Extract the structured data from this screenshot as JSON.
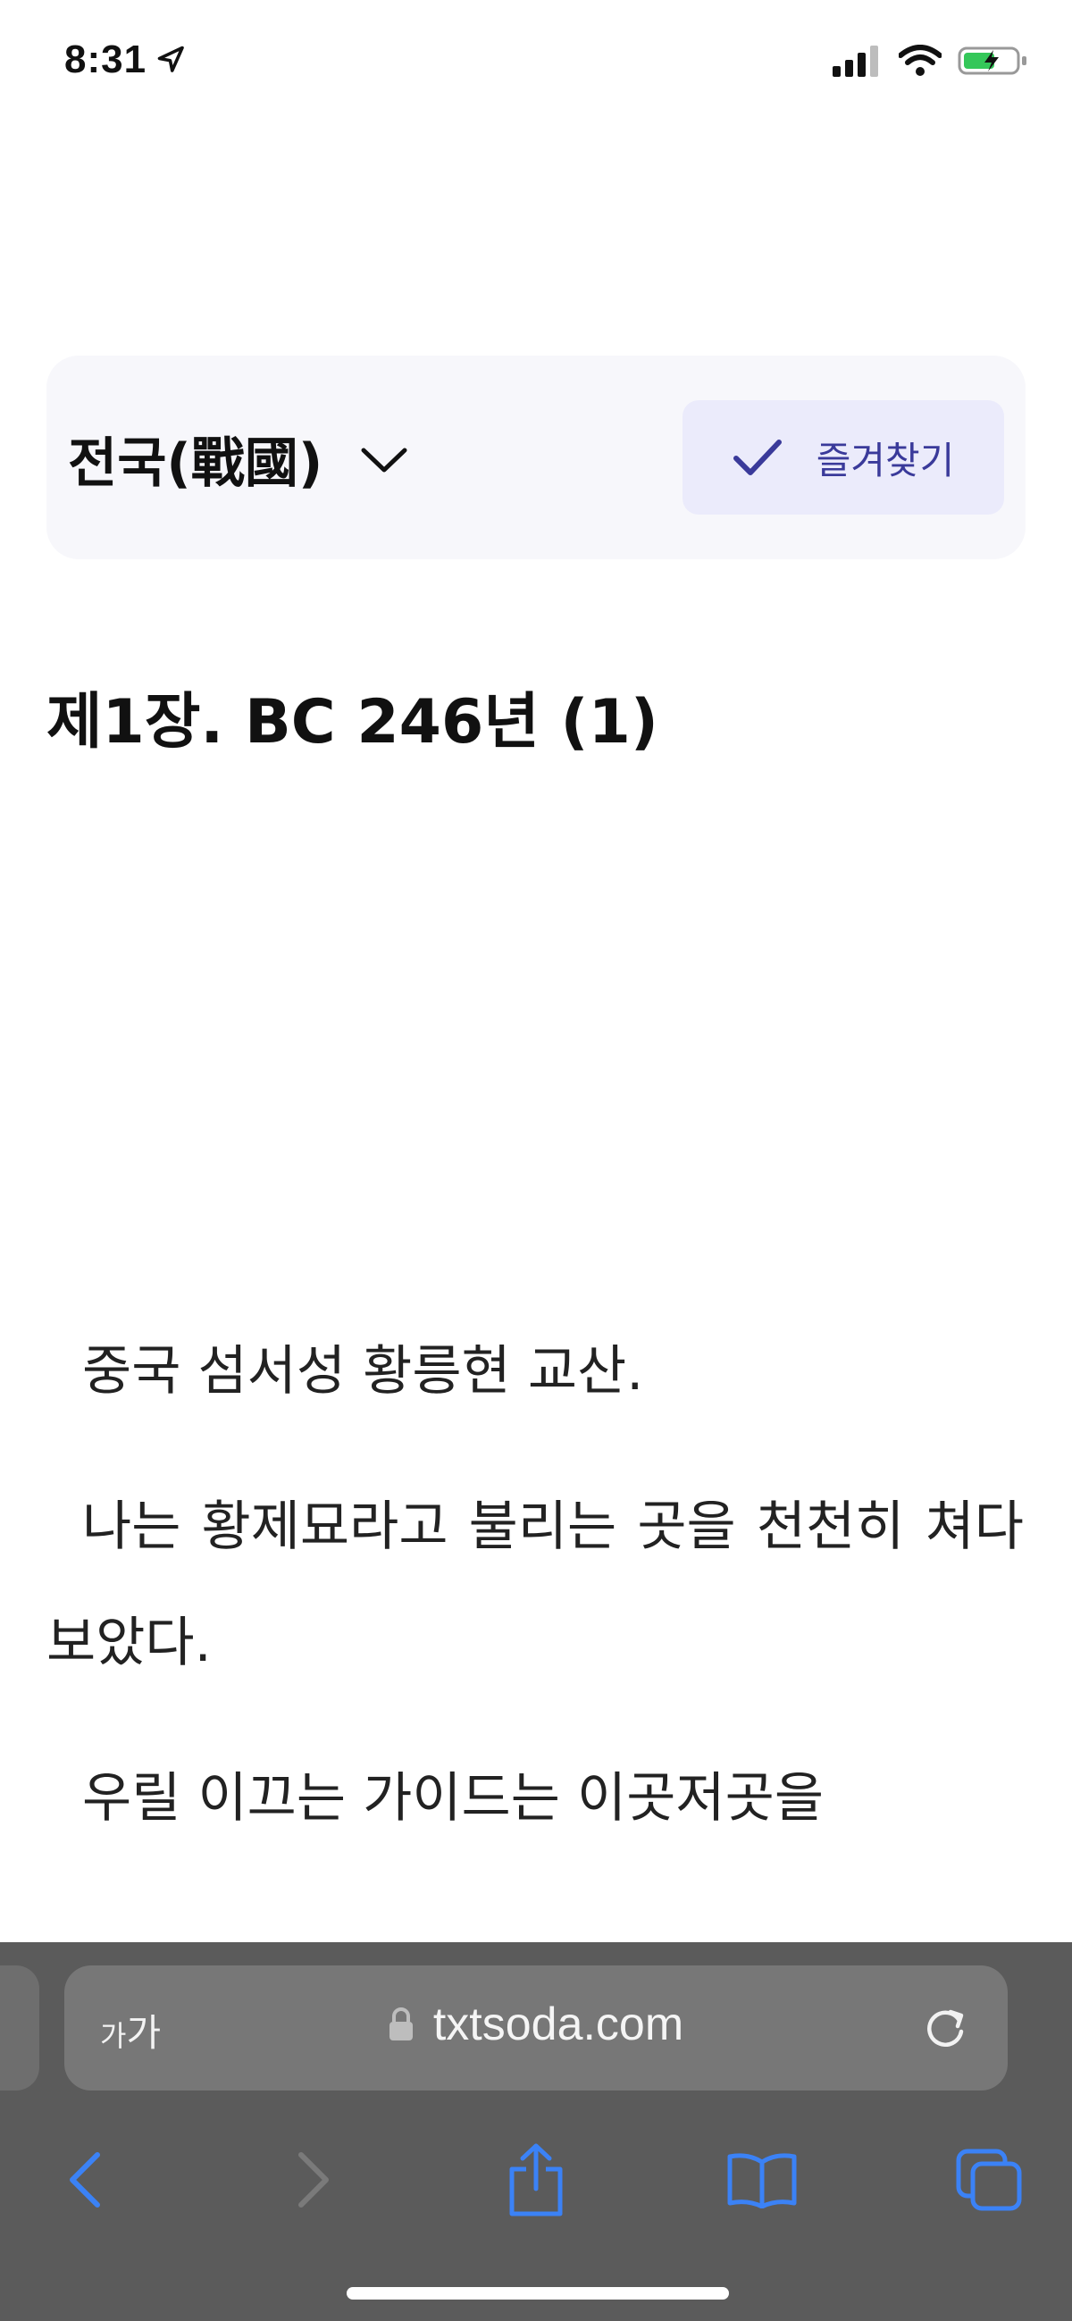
{
  "status_bar": {
    "time": "8:31",
    "icons": [
      "location-arrow-icon",
      "cellular-signal-icon",
      "wifi-icon",
      "battery-charging-icon"
    ]
  },
  "header": {
    "novel_title": "전국(戰國)",
    "favorite_label": "즐겨찾기"
  },
  "chapter": {
    "title": "제1장. BC 246년 (1)"
  },
  "content": {
    "paragraphs": [
      "중국 섬서성 황릉현 교산.",
      "나는 황제묘라고 불리는 곳을 천천히 쳐다보았다.",
      "우릴 이끄는 가이드는 이곳저곳을"
    ]
  },
  "browser": {
    "text_size_label_small": "가",
    "text_size_label_large": "가",
    "url": "txtsoda.com"
  },
  "colors": {
    "accent": "#3a3a9a",
    "toolbar_bg": "#5b5b5b",
    "address_bar_bg": "#777777",
    "nav_icon_active": "#3b82f6",
    "nav_icon_disabled": "#7a7a7a"
  }
}
